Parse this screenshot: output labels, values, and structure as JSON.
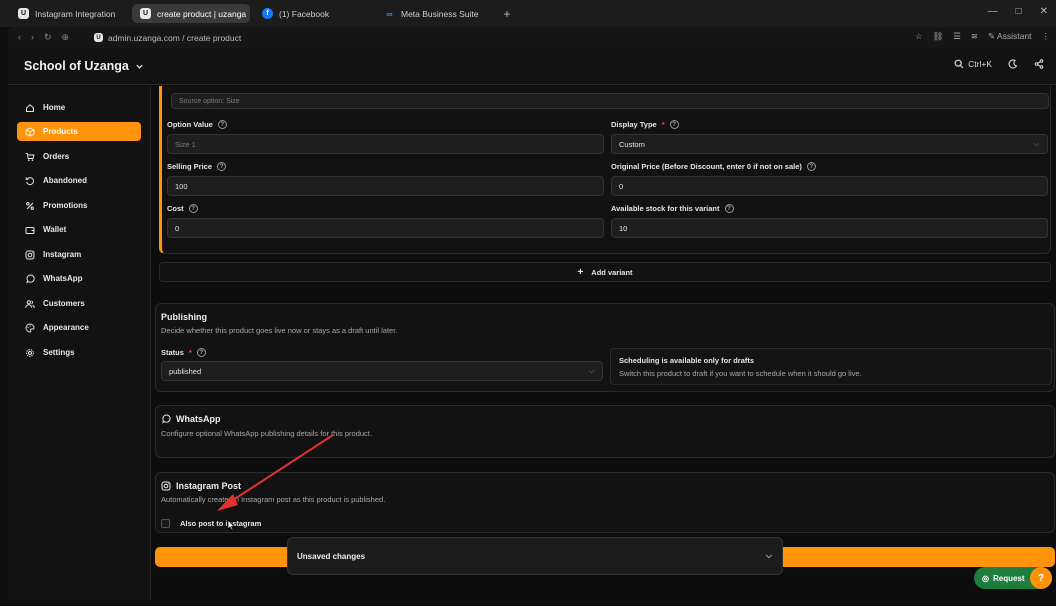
{
  "browser": {
    "tabs": [
      {
        "label": "Instagram Integration",
        "icon": "U"
      },
      {
        "label": "create product | uzanga",
        "icon": "U"
      },
      {
        "label": "(1) Facebook",
        "icon": "f"
      },
      {
        "label": "Meta Business Suite",
        "icon": "∞"
      }
    ],
    "new_tab": "+",
    "url": "admin.uzanga.com / create product",
    "assistant": "Assistant"
  },
  "header": {
    "brand": "School of Uzanga",
    "shortcut": "Ctrl+K"
  },
  "sidebar": {
    "items": [
      {
        "label": "Home",
        "icon": "home-icon"
      },
      {
        "label": "Products",
        "icon": "box-icon"
      },
      {
        "label": "Orders",
        "icon": "cart-icon"
      },
      {
        "label": "Abandoned",
        "icon": "undo-icon"
      },
      {
        "label": "Promotions",
        "icon": "percent-icon"
      },
      {
        "label": "Wallet",
        "icon": "wallet-icon"
      },
      {
        "label": "Instagram",
        "icon": "instagram-icon"
      },
      {
        "label": "WhatsApp",
        "icon": "whatsapp-icon"
      },
      {
        "label": "Customers",
        "icon": "users-icon"
      },
      {
        "label": "Appearance",
        "icon": "palette-icon"
      },
      {
        "label": "Settings",
        "icon": "gear-icon"
      }
    ]
  },
  "variant": {
    "source_option": "Source option: Size",
    "option_value_label": "Option Value",
    "option_value_placeholder": "Size 1",
    "display_type_label": "Display Type",
    "display_type_value": "Custom",
    "selling_price_label": "Selling Price",
    "selling_price_value": "100",
    "original_price_label": "Original Price (Before Discount, enter 0 if not on sale)",
    "original_price_value": "0",
    "cost_label": "Cost",
    "cost_value": "0",
    "stock_label": "Available stock for this variant",
    "stock_value": "10",
    "add_variant": "Add variant"
  },
  "publishing": {
    "title": "Publishing",
    "desc": "Decide whether this product goes live now or stays as a draft until later.",
    "status_label": "Status",
    "status_value": "published",
    "schedule_title": "Scheduling is available only for drafts",
    "schedule_desc": "Switch this product to draft if you want to schedule when it should go live."
  },
  "whatsapp": {
    "title": "WhatsApp",
    "desc": "Configure optional WhatsApp publishing details for this product."
  },
  "instagram": {
    "title": "Instagram Post",
    "desc": "Automatically create an Instagram post as this product is published.",
    "checkbox_label": "Also post to instagram"
  },
  "footer": {
    "unsaved": "Unsaved changes",
    "request": "Request"
  },
  "colors": {
    "accent": "#ff9309",
    "request_green": "#1e7d3c",
    "annotation_arrow": "#e53030"
  }
}
